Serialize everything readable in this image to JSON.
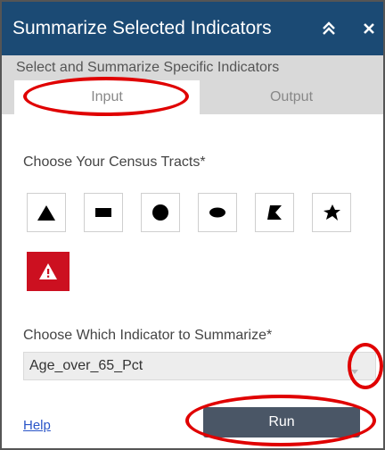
{
  "window": {
    "title": "Summarize Selected Indicators",
    "icons": {
      "collapse": "double-chevron-up-icon",
      "close": "close-icon"
    }
  },
  "subtitle": "Select and Summarize Specific Indicators",
  "tabs": [
    {
      "label": "Input",
      "selected": true
    },
    {
      "label": "Output",
      "selected": false
    }
  ],
  "tracts": {
    "label": "Choose Your Census Tracts*",
    "tools": [
      "triangle-icon",
      "rectangle-icon",
      "circle-icon",
      "ellipse-icon",
      "polygon-icon",
      "freehand-icon"
    ],
    "clear_tool": "warning-icon"
  },
  "indicator": {
    "label": "Choose Which Indicator to Summarize*",
    "selected": "Age_over_65_Pct"
  },
  "footer": {
    "help": "Help",
    "run": "Run"
  },
  "colors": {
    "title_bar": "#1b4a74",
    "tab_bar": "#d9d9d9",
    "clear_button": "#cc1020",
    "run_button": "#4a5666",
    "annotation": "#e00000",
    "link": "#2a55c8"
  }
}
